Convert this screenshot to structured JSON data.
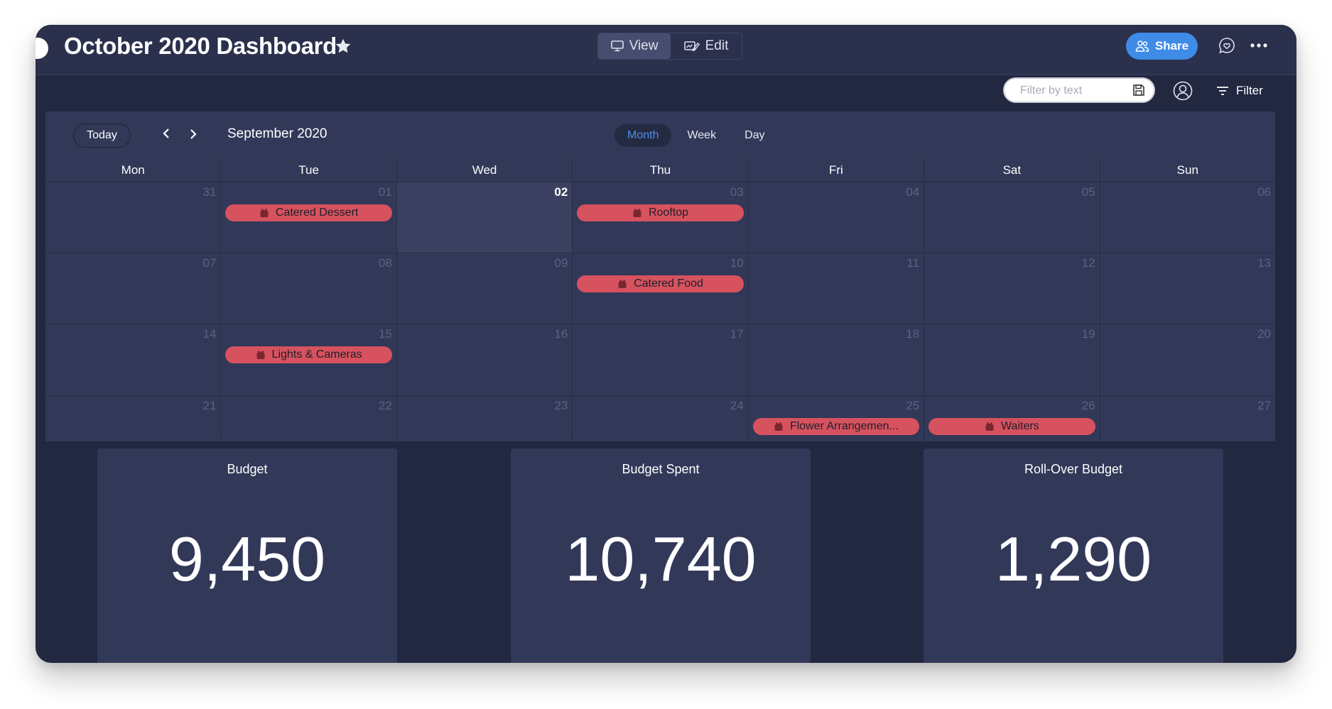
{
  "header": {
    "title": "October 2020 Dashboard",
    "favorite_icon": "star-icon",
    "view_label": "View",
    "edit_label": "Edit",
    "share_label": "Share",
    "icons": {
      "view": "monitor-icon",
      "edit": "chart-edit-icon",
      "share": "people-icon",
      "updates": "chat-heart-icon",
      "more": "more-horizontal-icon"
    }
  },
  "toolbar": {
    "filter_placeholder": "Filter by text",
    "filter_value": "",
    "filter_label": "Filter",
    "icons": {
      "save": "save-icon",
      "person": "person-icon",
      "filter": "filter-icon"
    }
  },
  "calendar": {
    "today_label": "Today",
    "month_label": "September 2020",
    "views": [
      {
        "label": "Month",
        "active": true
      },
      {
        "label": "Week",
        "active": false
      },
      {
        "label": "Day",
        "active": false
      }
    ],
    "weekdays": [
      "Mon",
      "Tue",
      "Wed",
      "Thu",
      "Fri",
      "Sat",
      "Sun"
    ],
    "weeks": [
      [
        {
          "day": "31"
        },
        {
          "day": "01",
          "event": "Catered Dessert"
        },
        {
          "day": "02",
          "today": true
        },
        {
          "day": "03",
          "event": "Rooftop"
        },
        {
          "day": "04"
        },
        {
          "day": "05"
        },
        {
          "day": "06"
        }
      ],
      [
        {
          "day": "07"
        },
        {
          "day": "08"
        },
        {
          "day": "09"
        },
        {
          "day": "10",
          "event": "Catered Food"
        },
        {
          "day": "11"
        },
        {
          "day": "12"
        },
        {
          "day": "13"
        }
      ],
      [
        {
          "day": "14"
        },
        {
          "day": "15",
          "event": "Lights & Cameras"
        },
        {
          "day": "16"
        },
        {
          "day": "17"
        },
        {
          "day": "18"
        },
        {
          "day": "19"
        },
        {
          "day": "20"
        }
      ],
      [
        {
          "day": "21"
        },
        {
          "day": "22"
        },
        {
          "day": "23"
        },
        {
          "day": "24"
        },
        {
          "day": "25",
          "event": "Flower Arrangemen..."
        },
        {
          "day": "26",
          "event": "Waiters"
        },
        {
          "day": "27"
        }
      ]
    ],
    "event_icon": "gift-icon",
    "event_color": "#d6525f"
  },
  "kpis": [
    {
      "title": "Budget",
      "value": "9,450"
    },
    {
      "title": "Budget Spent",
      "value": "10,740"
    },
    {
      "title": "Roll-Over Budget",
      "value": "1,290"
    }
  ],
  "colors": {
    "accent": "#3f8be8",
    "active_tab": "#4d8eea",
    "panel_bg": "#222840",
    "card_bg": "#323858"
  }
}
